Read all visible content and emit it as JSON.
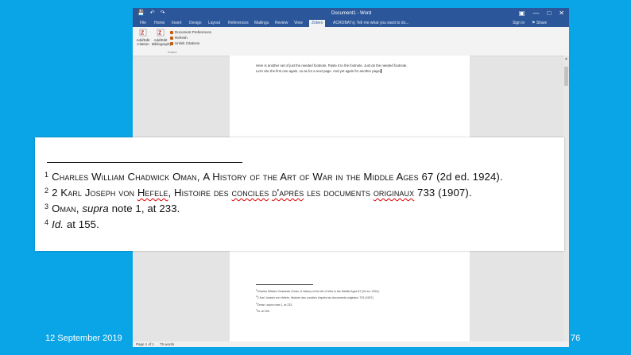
{
  "window": {
    "title": "Document1 - Word",
    "qat": [
      "save-icon",
      "undo-icon",
      "redo-icon"
    ],
    "controls": [
      "restore-ribbon-icon",
      "minimize-icon",
      "maximize-icon",
      "close-icon"
    ]
  },
  "tabs": [
    {
      "label": "File"
    },
    {
      "label": "Home"
    },
    {
      "label": "Insert"
    },
    {
      "label": "Design"
    },
    {
      "label": "Layout"
    },
    {
      "label": "References"
    },
    {
      "label": "Mailings"
    },
    {
      "label": "Review"
    },
    {
      "label": "View"
    },
    {
      "label": "Zotero"
    },
    {
      "label": "ACROBAT"
    }
  ],
  "tell_me": "Tell me what you want to do...",
  "sign_in": "Sign in",
  "share": "Share",
  "ribbon": {
    "btn1_line1": "Add/Edit",
    "btn1_line2": "Citation",
    "btn2_line1": "Add/Edit",
    "btn2_line2": "Bibliography",
    "list": [
      "Document Preferences",
      "Refresh",
      "Unlink Citations"
    ],
    "group": "Zotero"
  },
  "page": {
    "line1": "Here is another set of just the needed footnote. Paste it to the footnote. Just do the needed footnote.",
    "line2": "Let's cite the first one again, so as for a next page. And yet again for another page."
  },
  "mini_footnotes": [
    "Charles William Chadwick Oman, A History of the Art of War in the Middle Ages 67 (2d ed. 1924).",
    "2 Karl Joseph von Hefele, Histoire des conciles d'après les documents originaux 733 (1907).",
    "Oman, supra note 1, at 233.",
    "Id. at 155."
  ],
  "status": {
    "page": "Page 1 of 1",
    "words": "75 words"
  },
  "zoomed_footnotes": {
    "fn1": {
      "num": "1",
      "author": "Charles William Chadwick Oman",
      "title": "A History of the Art of War in the Middle Ages 67",
      "tail": "(2d ed. 1924)."
    },
    "fn2": {
      "num": "2",
      "prefix": "2 Karl Joseph von",
      "surname": "Hefele",
      "title_a": "Histoire des",
      "title_b": "conciles",
      "title_c": "d'après",
      "title_d": "les documents",
      "title_e": "originaux",
      "pages": "733",
      "tail": "(1907)."
    },
    "fn3": {
      "num": "3",
      "name": "Oman",
      "supra": "supra",
      "tail": "note 1, at 233."
    },
    "fn4": {
      "num": "4",
      "id": "Id.",
      "tail": "at 155."
    }
  },
  "slide": {
    "date": "12 September 2019",
    "number": "76"
  }
}
